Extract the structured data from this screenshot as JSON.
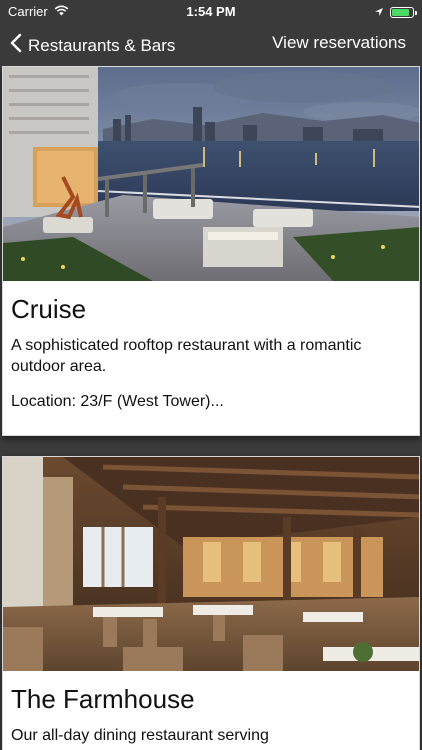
{
  "status": {
    "carrier": "Carrier",
    "time": "1:54 PM",
    "battery_level": 0.85,
    "battery_color": "#4cd964"
  },
  "nav": {
    "back_label": "Restaurants & Bars",
    "back_icon": "chevron-left-icon",
    "right_label": "View reservations"
  },
  "restaurants": [
    {
      "name": "Cruise",
      "description": "A sophisticated rooftop restaurant with a romantic outdoor area.",
      "location": "Location: 23/F (West Tower)..."
    },
    {
      "name": "The Farmhouse",
      "description": "Our all-day dining restaurant serving"
    }
  ],
  "colors": {
    "bar_background": "#3a3a3a",
    "page_background": "#3b3b3b",
    "card_background": "#ffffff"
  }
}
